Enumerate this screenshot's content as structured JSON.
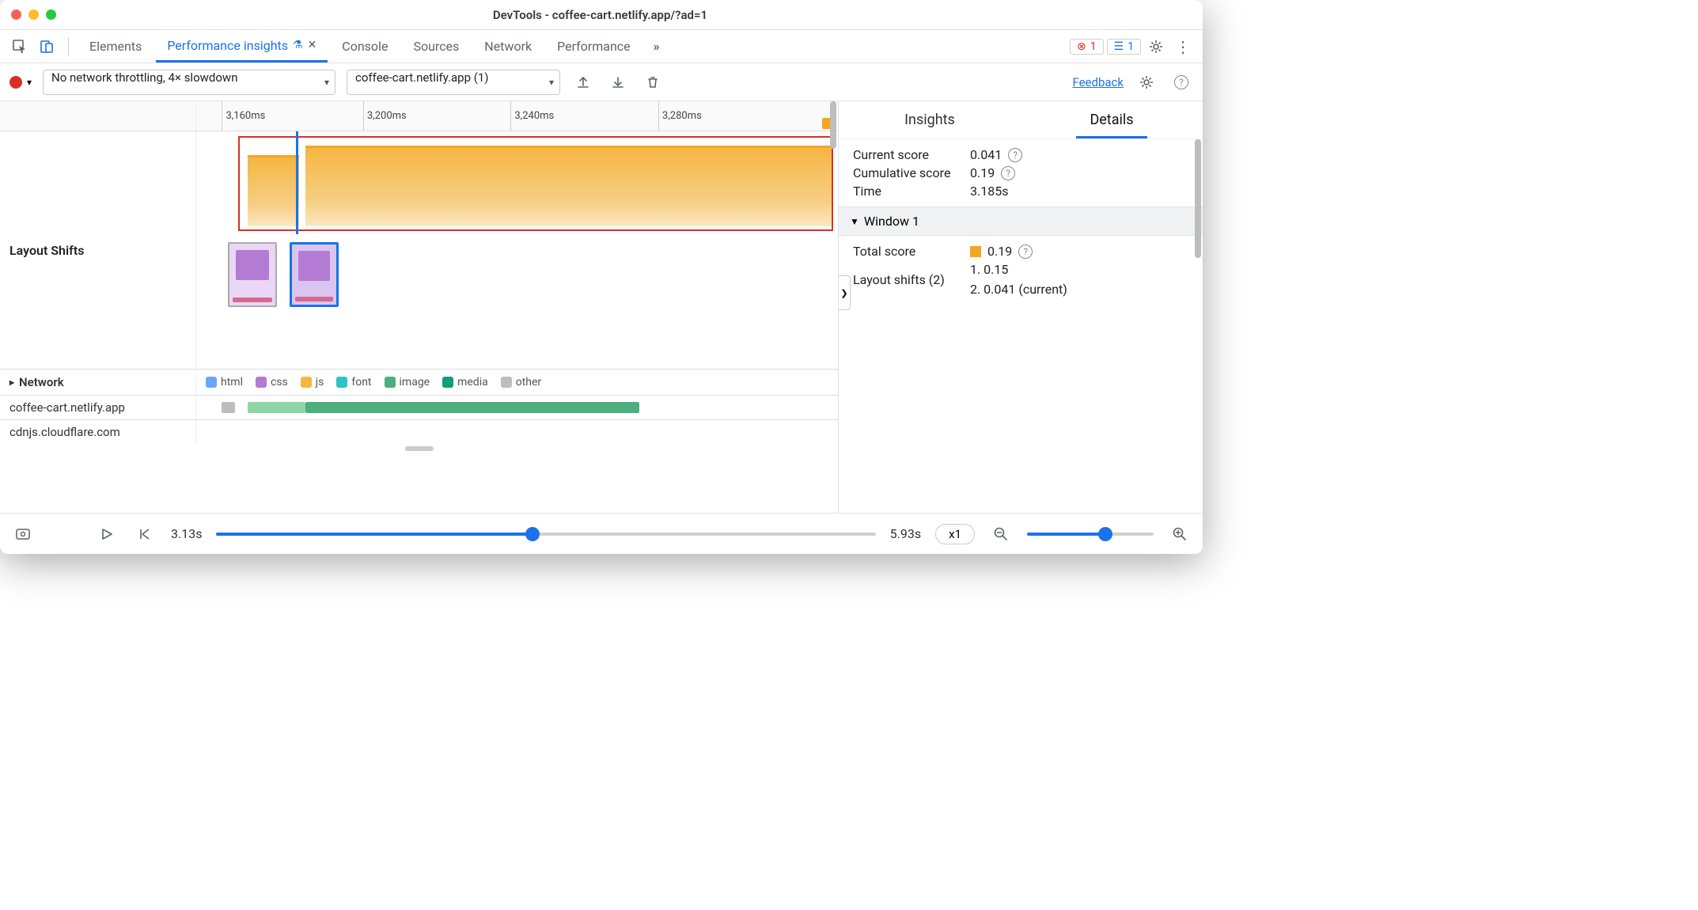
{
  "window": {
    "title": "DevTools - coffee-cart.netlify.app/?ad=1"
  },
  "tabs": {
    "elements": "Elements",
    "perf_insights": "Performance insights",
    "console": "Console",
    "sources": "Sources",
    "network": "Network",
    "performance": "Performance"
  },
  "badges": {
    "errors": "1",
    "issues": "1"
  },
  "toolbar": {
    "throttle": "No network throttling, 4× slowdown",
    "recording": "coffee-cart.netlify.app (1)",
    "feedback": "Feedback"
  },
  "timeline": {
    "ticks": [
      "3,160ms",
      "3,200ms",
      "3,240ms",
      "3,280ms"
    ],
    "layout_shifts_label": "Layout Shifts"
  },
  "legend": {
    "html": "html",
    "css": "css",
    "js": "js",
    "font": "font",
    "image": "image",
    "media": "media",
    "other": "other"
  },
  "colors": {
    "html": "#6aa6ff",
    "css": "#b37bd3",
    "js": "#f5b642",
    "font": "#2ec4c6",
    "image": "#4caf7d",
    "media": "#0f9d7a",
    "other": "#bdbdbd"
  },
  "network": {
    "label": "Network",
    "hosts": [
      "coffee-cart.netlify.app",
      "cdnjs.cloudflare.com"
    ]
  },
  "player": {
    "start": "3.13s",
    "end": "5.93s",
    "zoom": "x1"
  },
  "right": {
    "tabs": {
      "insights": "Insights",
      "details": "Details"
    },
    "current_score_label": "Current score",
    "current_score_value": "0.041",
    "cumulative_score_label": "Cumulative score",
    "cumulative_score_value": "0.19",
    "time_label": "Time",
    "time_value": "3.185s",
    "window_label": "Window 1",
    "total_score_label": "Total score",
    "total_score_value": "0.19",
    "layout_shifts_label": "Layout shifts (2)",
    "shift1": "1. 0.15",
    "shift2": "2. 0.041 (current)"
  }
}
